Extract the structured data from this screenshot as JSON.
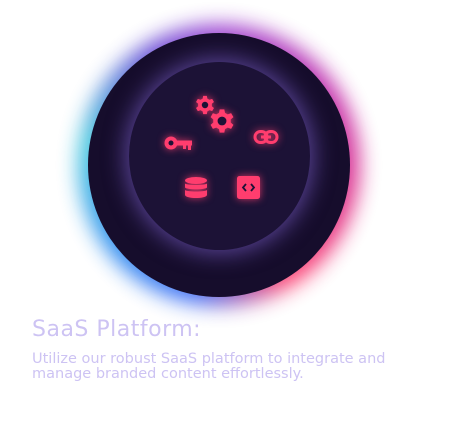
{
  "feature": {
    "title": "SaaS Platform:",
    "description": "Utilize our robust SaaS platform to integrate and manage branded content effortlessly.",
    "icons": [
      "gear-icon",
      "gear-icon",
      "key-icon",
      "link-icon",
      "database-icon",
      "code-icon"
    ]
  },
  "colors": {
    "icon": "#ff3d6e",
    "circle": "#160d2c",
    "text": "#cdc3f3"
  }
}
